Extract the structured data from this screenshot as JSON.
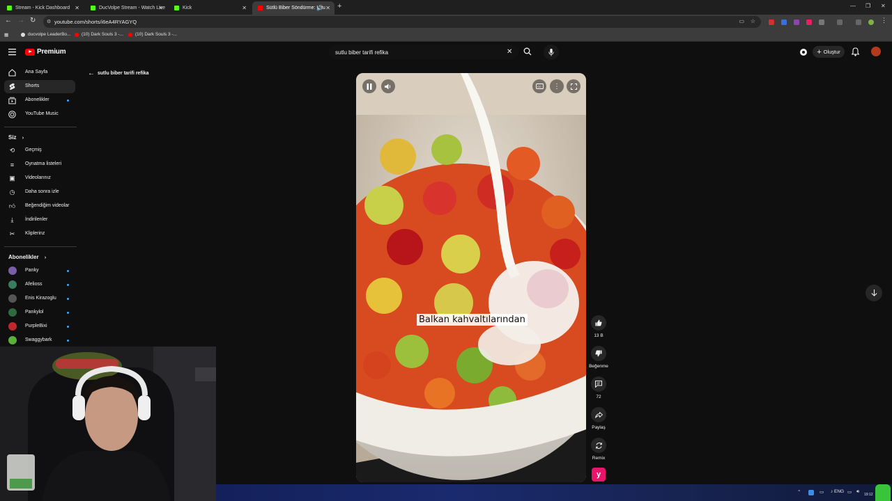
{
  "browser": {
    "tabs": [
      {
        "title": "Stream - Kick Dashboard",
        "favicon_color": "#53fc18"
      },
      {
        "title": "DucVolpe Stream - Watch Live",
        "favicon_color": "#53fc18"
      },
      {
        "title": "Kick",
        "favicon_color": "#53fc18"
      },
      {
        "title": "Sütlü Biber Söndürme: Uzu",
        "favicon_color": "#ff0000"
      }
    ],
    "url": "youtube.com/shorts/i6eA4RYAGYQ",
    "bookmarks": [
      {
        "label": "ducvolpe LeaderBo..."
      },
      {
        "label": "(10) Dark Souls 3 -..."
      },
      {
        "label": "(10) Dark Souls 3 -..."
      }
    ]
  },
  "header": {
    "logo_text": "Premium",
    "search_value": "sutlu biber tarifi refika",
    "create_label": "Oluştur"
  },
  "sidebar": {
    "main": [
      {
        "label": "Ana Sayfa",
        "icon": "home-icon"
      },
      {
        "label": "Shorts",
        "icon": "shorts-icon",
        "active": true
      },
      {
        "label": "Abonelikler",
        "icon": "subscriptions-icon"
      },
      {
        "label": "YouTube Music",
        "icon": "music-icon"
      }
    ],
    "you_heading": "Siz",
    "you": [
      {
        "label": "Geçmiş",
        "icon": "history-icon"
      },
      {
        "label": "Oynatma listeleri",
        "icon": "playlists-icon"
      },
      {
        "label": "Videolarınız",
        "icon": "your-videos-icon"
      },
      {
        "label": "Daha sonra izle",
        "icon": "watch-later-icon"
      },
      {
        "label": "Beğendiğim videolar",
        "icon": "liked-icon"
      },
      {
        "label": "İndirilenler",
        "icon": "downloads-icon"
      },
      {
        "label": "Kliplerinz",
        "icon": "clips-icon"
      }
    ],
    "subs_heading": "Abonelikler",
    "subs": [
      {
        "label": "Panky",
        "color": "#7b5ea8"
      },
      {
        "label": "Afelioss",
        "color": "#3a7d5e"
      },
      {
        "label": "Enis Kirazoglu",
        "color": "#555555"
      },
      {
        "label": "Pankylol",
        "color": "#2e6b3f"
      },
      {
        "label": "PurpleBixi",
        "color": "#c0282d"
      },
      {
        "label": "Swaggybark",
        "color": "#5bb03c"
      }
    ]
  },
  "page": {
    "back_query": "sutlu biber tarifi refika",
    "caption": "Balkan kahvaltılarından"
  },
  "actions": {
    "like_count": "13 B",
    "dislike_label": "Beğenme",
    "comment_count": "72",
    "share_label": "Paylaş",
    "remix_label": "Remix"
  },
  "taskbar": {
    "lang": "ENG",
    "time": "19:12"
  }
}
